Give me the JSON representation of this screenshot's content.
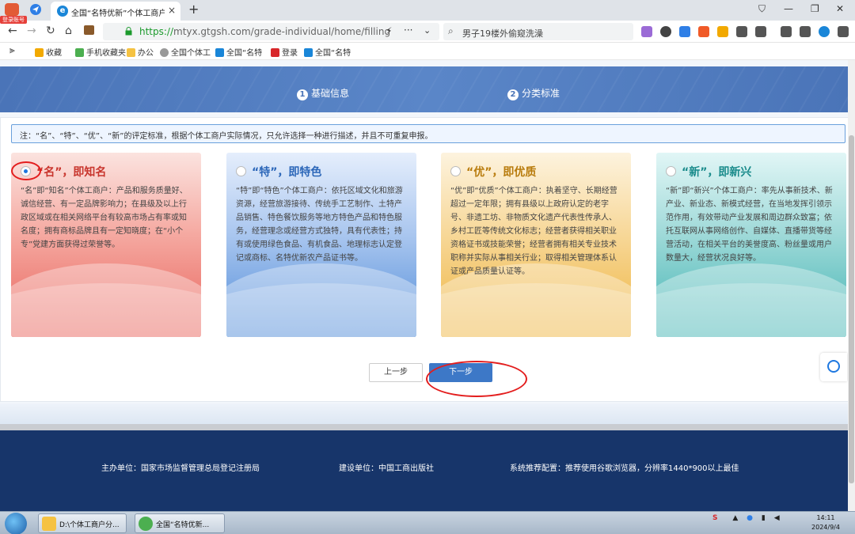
{
  "browser": {
    "login_badge": "登录账号",
    "tab_title": "全国“名特优新”个体工商户",
    "tab_close": "×",
    "new_tab": "+",
    "url_scheme": "https://",
    "url_rest": "mtyx.gtgsh.com/grade-individual/home/filling",
    "search_query": "男子19楼外偷窥洗澡",
    "nav_back": "←",
    "nav_forward": "→",
    "nav_reload": "↻",
    "nav_home": "⌂",
    "more": "···",
    "chevron": "⌄",
    "search_icon": "⌕",
    "window_controls": [
      "⛉",
      "—",
      "❐",
      "✕"
    ]
  },
  "bookmarks": {
    "toggle": "⫸",
    "items": [
      "收藏",
      "手机收藏夹",
      "办公",
      "全国个体工",
      "全国“名特",
      "登录",
      "全国“名特"
    ]
  },
  "steps": {
    "step1_num": "1",
    "step1_label": "基础信息",
    "step2_num": "2",
    "step2_label": "分类标准"
  },
  "notice": "注：“名”、“特”、“优”、“新”的评定标准，根据个体工商户实际情况，只允许选择一种进行描述，并且不可重复申报。",
  "cards": [
    {
      "title": "“名”，即知名",
      "selected": true,
      "desc": "“名”即“知名”个体工商户：产品和服务质量好、诚信经营、有一定品牌影响力；在县级及以上行政区域或在相关网络平台有较高市场占有率或知名度；拥有商标品牌且有一定知晓度；在“小个专”党建方面获得过荣誉等。"
    },
    {
      "title": "“特”，即特色",
      "selected": false,
      "desc": "“特”即“特色”个体工商户：依托区域文化和旅游资源，经营旅游接待、传统手工艺制作、土特产品销售、特色餐饮服务等地方特色产品和特色服务，经营理念或经营方式独特，具有代表性；持有或使用绿色食品、有机食品、地理标志认定登记或商标、名特优新农产品证书等。"
    },
    {
      "title": "“优”，即优质",
      "selected": false,
      "desc": "“优”即“优质”个体工商户：执着坚守、长期经营超过一定年限；拥有县级以上政府认定的老字号、非遗工坊、非物质文化遗产代表性传承人、乡村工匠等传统文化标志；经营者获得相关职业资格证书或技能荣誉；经营者拥有相关专业技术职称并实际从事相关行业；取得相关管理体系认证或产品质量认证等。"
    },
    {
      "title": "“新”，即新兴",
      "selected": false,
      "desc": "“新”即“新兴”个体工商户：率先从事新技术、新产业、新业态、新模式经营，在当地发挥引领示范作用，有效带动产业发展和周边群众致富；依托互联网从事网络创作、自媒体、直播带货等经营活动，在相关平台的美誉度高、粉丝量或用户数量大，经营状况良好等。"
    }
  ],
  "buttons": {
    "prev": "上一步",
    "next": "下一步"
  },
  "footer": {
    "host": "主办单位：国家市场监督管理总局登记注册局",
    "builder": "建设单位：中国工商出版社",
    "config": "系统推荐配置：推荐使用谷歌浏览器，分辨率1440*900以上最佳"
  },
  "taskbar": {
    "task1": "D:\\个体工商户分...",
    "task2": "全国“名特优新...",
    "time": "14:11",
    "date": "2024/9/4"
  },
  "colors": {
    "accent_blue": "#3d78c7",
    "footer_navy": "#17356a",
    "annotation_red": "#e31d1d"
  }
}
